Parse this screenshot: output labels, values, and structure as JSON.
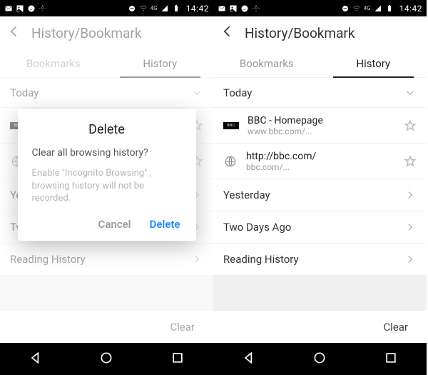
{
  "status": {
    "time": "14:42",
    "net_label": "4G"
  },
  "appbar": {
    "title": "History/Bookmark"
  },
  "tabs": {
    "bookmarks": "Bookmarks",
    "history": "History"
  },
  "sections": {
    "today": "Today",
    "yesterday": "Yesterday",
    "two_days": "Two Days Ago",
    "reading": "Reading History"
  },
  "items": [
    {
      "title": "BBC - Homepage",
      "url": "www.bbc.com/..."
    },
    {
      "title": "http://bbc.com/",
      "url": "bbc.com/..."
    }
  ],
  "left_truncated": {
    "yesterday": "Ye",
    "two_days": "Tv"
  },
  "clear": "Clear",
  "dialog": {
    "title": "Delete",
    "message": "Clear all browsing history?",
    "note": "Enable \"Incognito Browsing\" , browsing history will not be recorded.",
    "cancel": "Cancel",
    "confirm": "Delete"
  }
}
